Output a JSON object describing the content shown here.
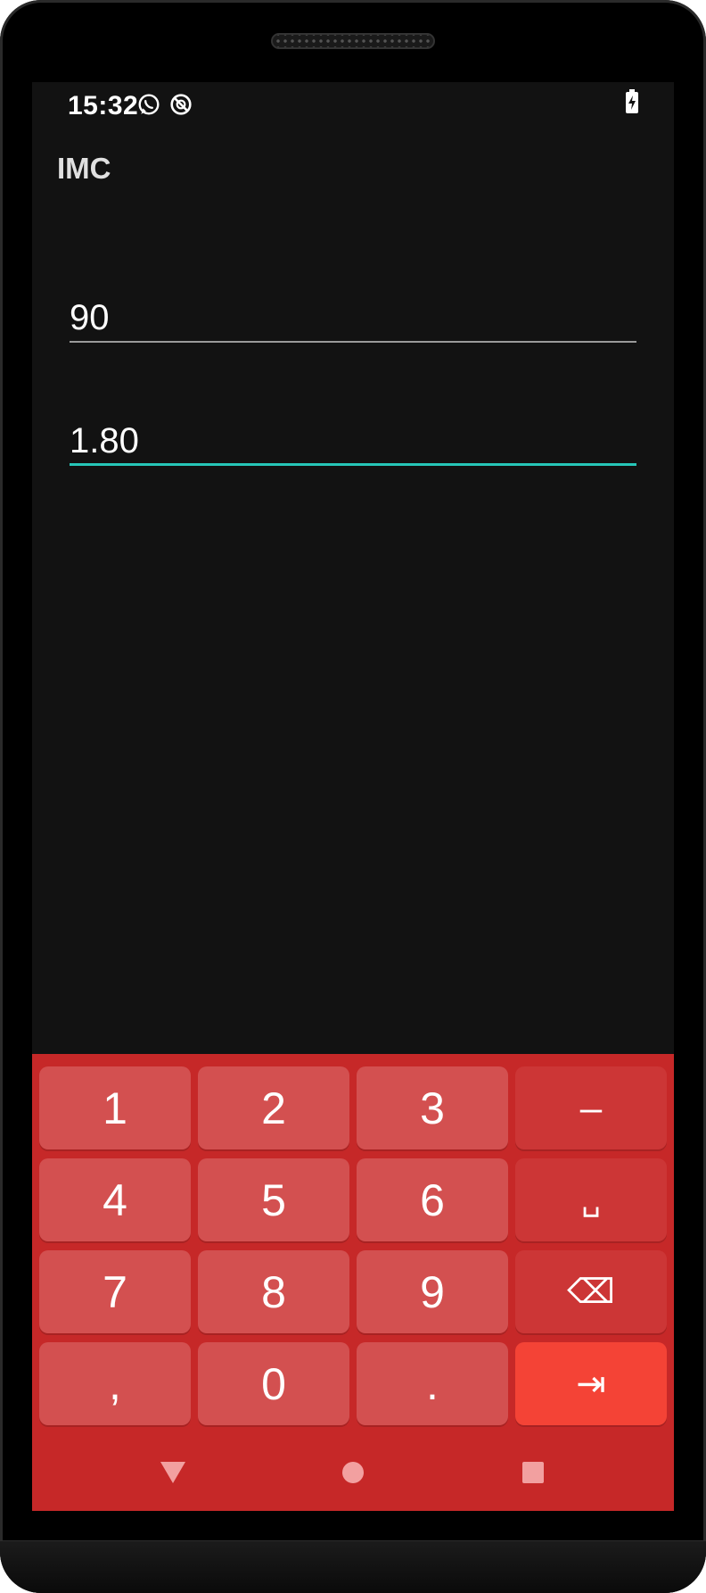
{
  "status_bar": {
    "time": "15:32",
    "icons": [
      "whatsapp-icon",
      "no-disturb-icon"
    ],
    "battery_icon": "battery-charging-icon"
  },
  "app": {
    "title": "IMC"
  },
  "fields": {
    "weight_value": "90",
    "height_value": "1.80"
  },
  "keyboard": {
    "rows": [
      [
        "1",
        "2",
        "3",
        "–"
      ],
      [
        "4",
        "5",
        "6",
        "␣"
      ],
      [
        "7",
        "8",
        "9",
        "⌫"
      ],
      [
        ",",
        "0",
        ".",
        "⇥"
      ]
    ]
  },
  "colors": {
    "accent": "#26c6b8",
    "keyboard_bg": "#c62828",
    "key_bg": "#d35050",
    "enter_key": "#f44336"
  }
}
